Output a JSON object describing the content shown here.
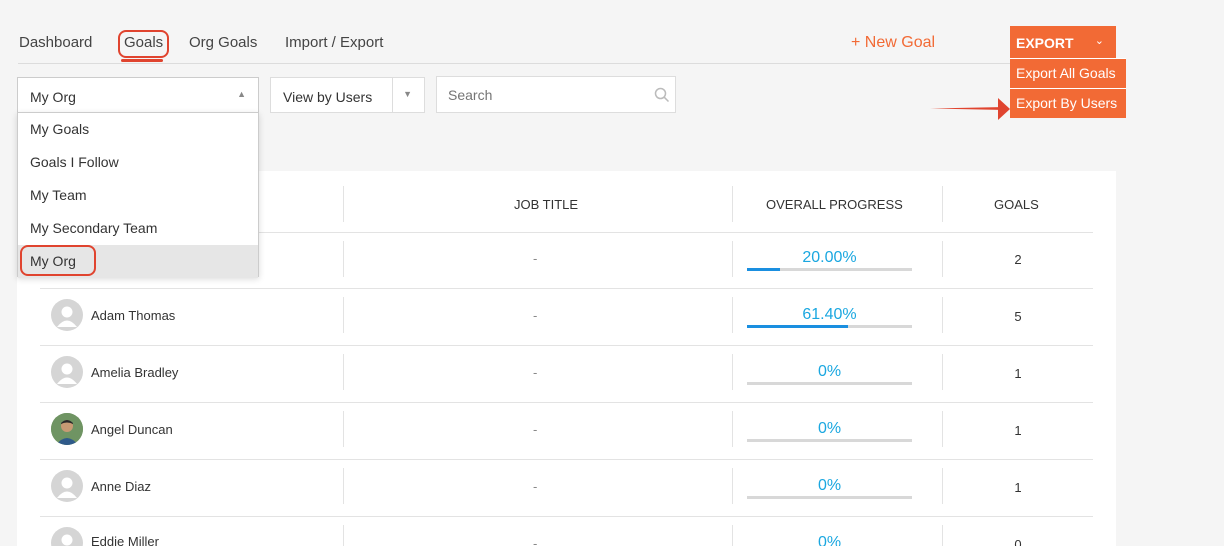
{
  "nav": {
    "tabs": [
      "Dashboard",
      "Goals",
      "Org Goals",
      "Import / Export"
    ],
    "new_goal": "+ New Goal"
  },
  "export": {
    "label": "EXPORT",
    "items": [
      "Export All Goals",
      "Export By Users"
    ]
  },
  "filters": {
    "org_select": "My Org",
    "view_select": "View by Users",
    "search_placeholder": "Search"
  },
  "dropdown": {
    "options": [
      "My Goals",
      "Goals I Follow",
      "My Team",
      "My Secondary Team",
      "My Org"
    ],
    "selected": "My Org"
  },
  "table": {
    "headers": [
      "JOB TITLE",
      "OVERALL PROGRESS",
      "GOALS"
    ],
    "rows": [
      {
        "name": "",
        "job": "-",
        "progress": "20.00%",
        "progress_value": 0.2,
        "goals": "2"
      },
      {
        "name": "Adam Thomas",
        "job": "-",
        "progress": "61.40%",
        "progress_value": 0.614,
        "goals": "5"
      },
      {
        "name": "Amelia Bradley",
        "job": "-",
        "progress": "0%",
        "progress_value": 0,
        "goals": "1"
      },
      {
        "name": "Angel Duncan",
        "job": "-",
        "progress": "0%",
        "progress_value": 0,
        "goals": "1"
      },
      {
        "name": "Anne Diaz",
        "job": "-",
        "progress": "0%",
        "progress_value": 0,
        "goals": "1"
      },
      {
        "name": "Eddie Miller",
        "job": "-",
        "progress": "0%",
        "progress_value": 0,
        "goals": "0"
      }
    ]
  },
  "colors": {
    "accent": "#f26a35",
    "highlight": "#e0442f",
    "progress_text": "#1aa7e0",
    "progress_fill": "#1a8fe0"
  }
}
